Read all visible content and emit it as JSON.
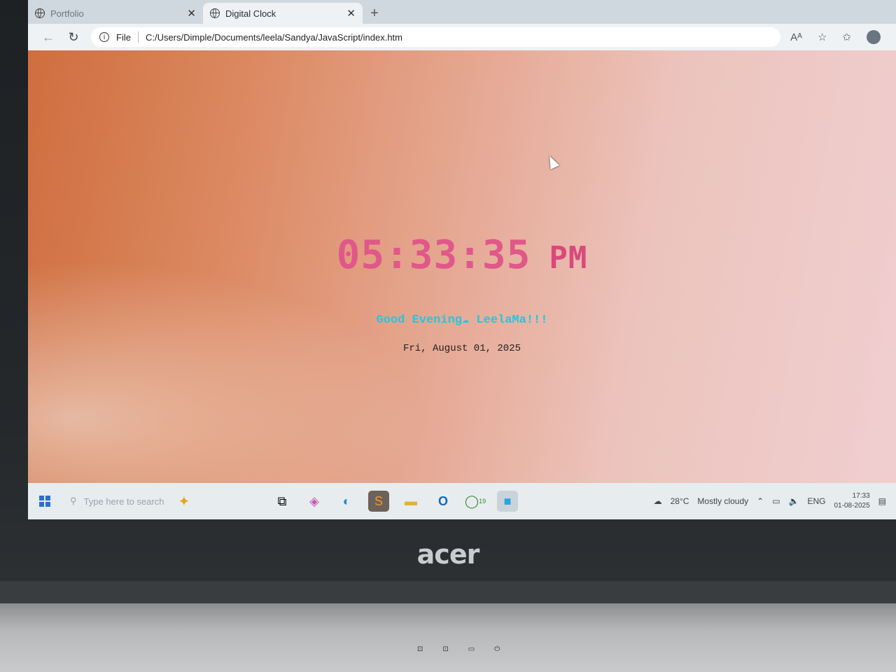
{
  "browser": {
    "tabs": [
      {
        "label": "Portfolio",
        "active": false
      },
      {
        "label": "Digital Clock",
        "active": true
      }
    ],
    "new_tab_glyph": "+",
    "address_prefix": "File",
    "url": "C:/Users/Dimple/Documents/leela/Sandya/JavaScript/index.htm"
  },
  "page": {
    "time": "05:33:35",
    "ampm": "PM",
    "greeting": "Good Evening☁ LeelaMa!!!",
    "date": "Fri, August 01, 2025",
    "colors": {
      "time": "#e0588a",
      "greeting": "#22c7e0",
      "date": "#222222"
    }
  },
  "taskbar": {
    "search_placeholder": "Type here to search",
    "whatsapp_badge": "19",
    "weather_temp": "28°C",
    "weather_text": "Mostly cloudy",
    "language": "ENG",
    "time": "17:33",
    "date": "01-08-2025"
  },
  "device": {
    "brand": "acer"
  }
}
